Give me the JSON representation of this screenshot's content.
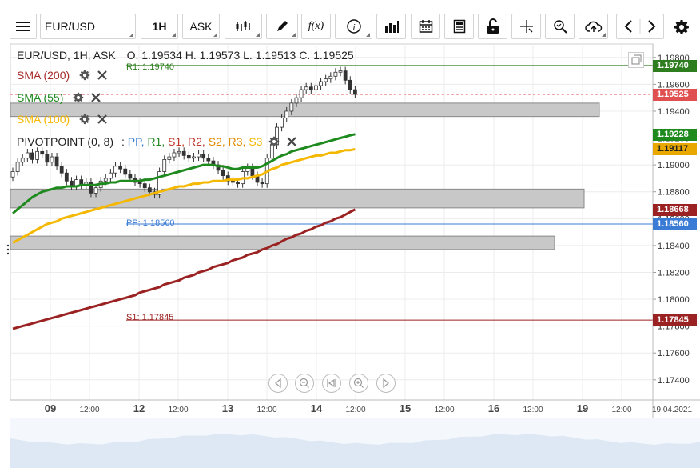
{
  "toolbar": {
    "symbol": "EUR/USD",
    "timeframe": "1H",
    "price_type": "ASK",
    "fx_label": "f(x)",
    "info_label": "i"
  },
  "header": {
    "instrument": "EUR/USD, 1H, ASK",
    "ohlc": "O. 1.19534 H. 1.19573 L. 1.19513 C. 1.19525"
  },
  "indicators": [
    {
      "label": "SMA (200)",
      "color": "#a52a2a"
    },
    {
      "label": "SMA (55)",
      "color": "#1e8a1e"
    },
    {
      "label": "SMA (100)",
      "color": "#f5b800"
    }
  ],
  "pivot": {
    "label": "PIVOTPOINT (0, 8)",
    "sep": ":",
    "items": [
      {
        "label": "PP,",
        "color": "#3a7bd5"
      },
      {
        "label": "R1,",
        "color": "#1e8a1e"
      },
      {
        "label": "S1,",
        "color": "#c0392b"
      },
      {
        "label": "R2,",
        "color": "#c0392b"
      },
      {
        "label": "S2,",
        "color": "#e08a00"
      },
      {
        "label": "R3,",
        "color": "#e08a00"
      },
      {
        "label": "S3",
        "color": "#f5b800"
      }
    ]
  },
  "levels": {
    "r1": "R1: 1.19740",
    "pp": "PP: 1.18560",
    "s1": "S1: 1.17845"
  },
  "price_tags": [
    {
      "value": "1.19740",
      "y": 1.1974,
      "color": "#2e7d1e"
    },
    {
      "value": "1.19525",
      "y": 1.19525,
      "color": "#e05050"
    },
    {
      "value": "1.19228",
      "y": 1.19228,
      "color": "#1e8a1e"
    },
    {
      "value": "1.19117",
      "y": 1.19117,
      "color": "#e8a800"
    },
    {
      "value": "1.18668",
      "y": 1.18668,
      "color": "#9b2222"
    },
    {
      "value": "1.18560",
      "y": 1.1856,
      "color": "#3a7bd5"
    },
    {
      "value": "1.17845",
      "y": 1.17845,
      "color": "#9b2222"
    }
  ],
  "chart_data": {
    "type": "candlestick",
    "ylim": [
      1.1725,
      1.199
    ],
    "y_ticks": [
      "1.19800",
      "1.19600",
      "1.19400",
      "1.19200",
      "1.19000",
      "1.18800",
      "1.18600",
      "1.18400",
      "1.18200",
      "1.18000",
      "1.17800",
      "1.17600",
      "1.17400"
    ],
    "x_ticks": [
      {
        "label": "09",
        "bold": true
      },
      {
        "label": "12:00",
        "bold": false
      },
      {
        "label": "12",
        "bold": true
      },
      {
        "label": "12:00",
        "bold": false
      },
      {
        "label": "13",
        "bold": true
      },
      {
        "label": "12:00",
        "bold": false
      },
      {
        "label": "14",
        "bold": true
      },
      {
        "label": "12:00",
        "bold": false
      },
      {
        "label": "15",
        "bold": true
      },
      {
        "label": "12:00",
        "bold": false
      },
      {
        "label": "16",
        "bold": true
      },
      {
        "label": "12:00",
        "bold": false
      },
      {
        "label": "19",
        "bold": true
      },
      {
        "label": "12:00",
        "bold": false
      },
      {
        "label": "19.04.2021",
        "bold": false
      }
    ],
    "zones": [
      {
        "y1": 1.1946,
        "y2": 1.1936
      },
      {
        "y1": 1.1882,
        "y2": 1.1868
      },
      {
        "y1": 1.1847,
        "y2": 1.1837
      }
    ],
    "close": [
      1.1895,
      1.1902,
      1.1905,
      1.1909,
      1.1904,
      1.191,
      1.1908,
      1.1902,
      1.1906,
      1.1899,
      1.1894,
      1.1888,
      1.1884,
      1.1889,
      1.1885,
      1.1887,
      1.1879,
      1.1883,
      1.1888,
      1.189,
      1.1894,
      1.1899,
      1.1897,
      1.1893,
      1.189,
      1.1887,
      1.1886,
      1.1883,
      1.188,
      1.1878,
      1.1895,
      1.1904,
      1.1906,
      1.1909,
      1.191,
      1.1907,
      1.1905,
      1.1906,
      1.1908,
      1.1905,
      1.1903,
      1.19,
      1.1896,
      1.1892,
      1.1888,
      1.1887,
      1.1886,
      1.1895,
      1.1898,
      1.1892,
      1.1887,
      1.1886,
      1.1905,
      1.1915,
      1.1928,
      1.1935,
      1.194,
      1.1946,
      1.195,
      1.1956,
      1.1958,
      1.1956,
      1.1959,
      1.1962,
      1.1964,
      1.1966,
      1.1969,
      1.197,
      1.1963,
      1.1956,
      1.19525
    ],
    "sma55": [
      1.1864,
      1.1867,
      1.187,
      1.1873,
      1.1876,
      1.1878,
      1.188,
      1.1881,
      1.1882,
      1.1883,
      1.1883,
      1.1884,
      1.1884,
      1.1884,
      1.1885,
      1.1885,
      1.1885,
      1.1885,
      1.1886,
      1.1886,
      1.1887,
      1.1887,
      1.1888,
      1.1888,
      1.1888,
      1.1888,
      1.1888,
      1.1889,
      1.1889,
      1.189,
      1.1891,
      1.1892,
      1.1893,
      1.1894,
      1.1895,
      1.1896,
      1.1897,
      1.1898,
      1.1899,
      1.19,
      1.19,
      1.19,
      1.1899,
      1.1899,
      1.1898,
      1.1897,
      1.1897,
      1.1898,
      1.1898,
      1.1898,
      1.1898,
      1.1899,
      1.1901,
      1.1903,
      1.1905,
      1.1907,
      1.1908,
      1.191,
      1.1911,
      1.1912,
      1.1913,
      1.1914,
      1.1915,
      1.1916,
      1.1917,
      1.1918,
      1.1919,
      1.192,
      1.1921,
      1.1922,
      1.19228
    ],
    "sma100": [
      1.1842,
      1.1844,
      1.1846,
      1.1848,
      1.185,
      1.1852,
      1.1854,
      1.1856,
      1.1857,
      1.1858,
      1.186,
      1.1861,
      1.1862,
      1.1863,
      1.1864,
      1.1865,
      1.1866,
      1.1867,
      1.1868,
      1.1869,
      1.187,
      1.1871,
      1.1872,
      1.1873,
      1.1874,
      1.1875,
      1.1876,
      1.1877,
      1.1878,
      1.1879,
      1.188,
      1.1881,
      1.1882,
      1.1883,
      1.1884,
      1.1884,
      1.1885,
      1.1886,
      1.1886,
      1.1887,
      1.1887,
      1.1888,
      1.1888,
      1.1888,
      1.1889,
      1.1889,
      1.1889,
      1.189,
      1.189,
      1.1891,
      1.1892,
      1.1893,
      1.1895,
      1.1897,
      1.1898,
      1.19,
      1.1901,
      1.1902,
      1.1903,
      1.1904,
      1.1905,
      1.1906,
      1.1907,
      1.1907,
      1.1908,
      1.1909,
      1.1909,
      1.191,
      1.1911,
      1.1911,
      1.19117
    ],
    "sma200": [
      1.1778,
      1.1779,
      1.178,
      1.1781,
      1.1782,
      1.1783,
      1.1784,
      1.1785,
      1.1786,
      1.1787,
      1.1788,
      1.1789,
      1.179,
      1.1791,
      1.1792,
      1.1793,
      1.1794,
      1.1795,
      1.1796,
      1.1797,
      1.1798,
      1.1799,
      1.18,
      1.1801,
      1.1802,
      1.1803,
      1.1805,
      1.1806,
      1.1807,
      1.1808,
      1.1809,
      1.1811,
      1.1812,
      1.1813,
      1.1814,
      1.1816,
      1.1817,
      1.1818,
      1.182,
      1.1821,
      1.1822,
      1.1824,
      1.1825,
      1.1826,
      1.1827,
      1.1829,
      1.183,
      1.1831,
      1.1833,
      1.1834,
      1.1835,
      1.1837,
      1.1838,
      1.184,
      1.1841,
      1.1843,
      1.1845,
      1.1846,
      1.1848,
      1.1849,
      1.1851,
      1.1852,
      1.1854,
      1.1855,
      1.1857,
      1.1858,
      1.186,
      1.1861,
      1.1863,
      1.1865,
      1.18668
    ]
  }
}
